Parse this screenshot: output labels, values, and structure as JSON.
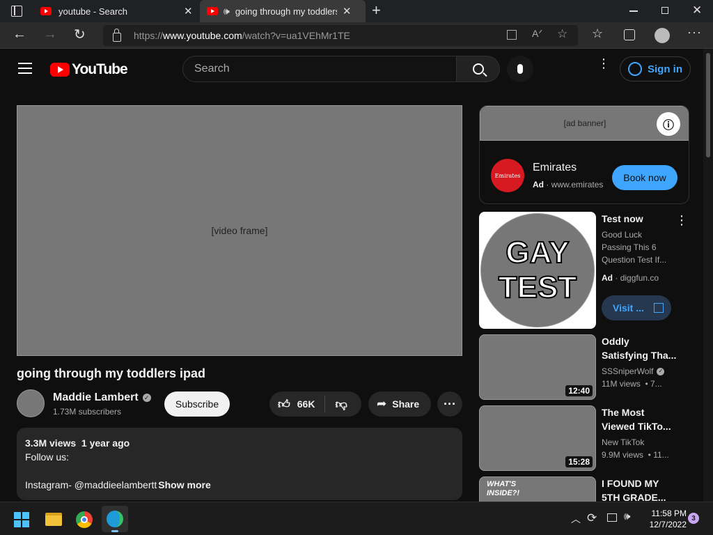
{
  "browser": {
    "tabs": [
      {
        "title": "youtube - Search",
        "active": false
      },
      {
        "title": "going through my toddlers ipad",
        "active": true
      }
    ],
    "url_prefix": "https://",
    "url_host": "www.youtube.com",
    "url_path": "/watch?v=ua1VEhMr1TE"
  },
  "youtube": {
    "logo_text": "YouTube",
    "search_placeholder": "Search",
    "signin_label": "Sign in"
  },
  "video": {
    "title": "going through my toddlers ipad",
    "channel": "Maddie Lambert",
    "subscribers": "1.73M subscribers",
    "subscribe_label": "Subscribe",
    "likes": "66K",
    "share_label": "Share",
    "description": {
      "stats": "3.3M views  1 year ago",
      "line1": "Follow us:",
      "line2": "Instagram- @maddieelambertt",
      "show_more": "Show more"
    }
  },
  "ad": {
    "advertiser": "Emirates",
    "ad_badge": "Ad",
    "domain": "www.emirates",
    "cta": "Book now",
    "logo_text": "Emirates"
  },
  "recommendations": [
    {
      "title": "Test now",
      "meta1": "Good Luck",
      "meta2": "Passing This 6",
      "meta3": "Question Test If...",
      "badge": "Ad",
      "domain": "diggfun.co",
      "cta": "Visit ...",
      "thumb_line1": "GAY",
      "thumb_line2": "TEST"
    },
    {
      "title1": "Oddly",
      "title2": "Satisfying Tha...",
      "channel": "SSSniperWolf",
      "stats": "11M views  • 7...",
      "duration": "12:40"
    },
    {
      "title1": "The Most",
      "title2": "Viewed TikTo...",
      "channel": "New TikTok",
      "stats": "9.9M views  • 11...",
      "duration": "15:28"
    },
    {
      "title1": "I FOUND MY",
      "title2": "5TH GRADE...",
      "thumb_text1": "WHAT'S",
      "thumb_text2": "INSIDE?!"
    }
  ],
  "taskbar": {
    "time": "11:58 PM",
    "date": "12/7/2022",
    "notifications": "3"
  },
  "colors": {
    "accent_blue": "#3ea6ff",
    "yt_red": "#ff0000",
    "cta_blue": "#3ea6ff"
  }
}
